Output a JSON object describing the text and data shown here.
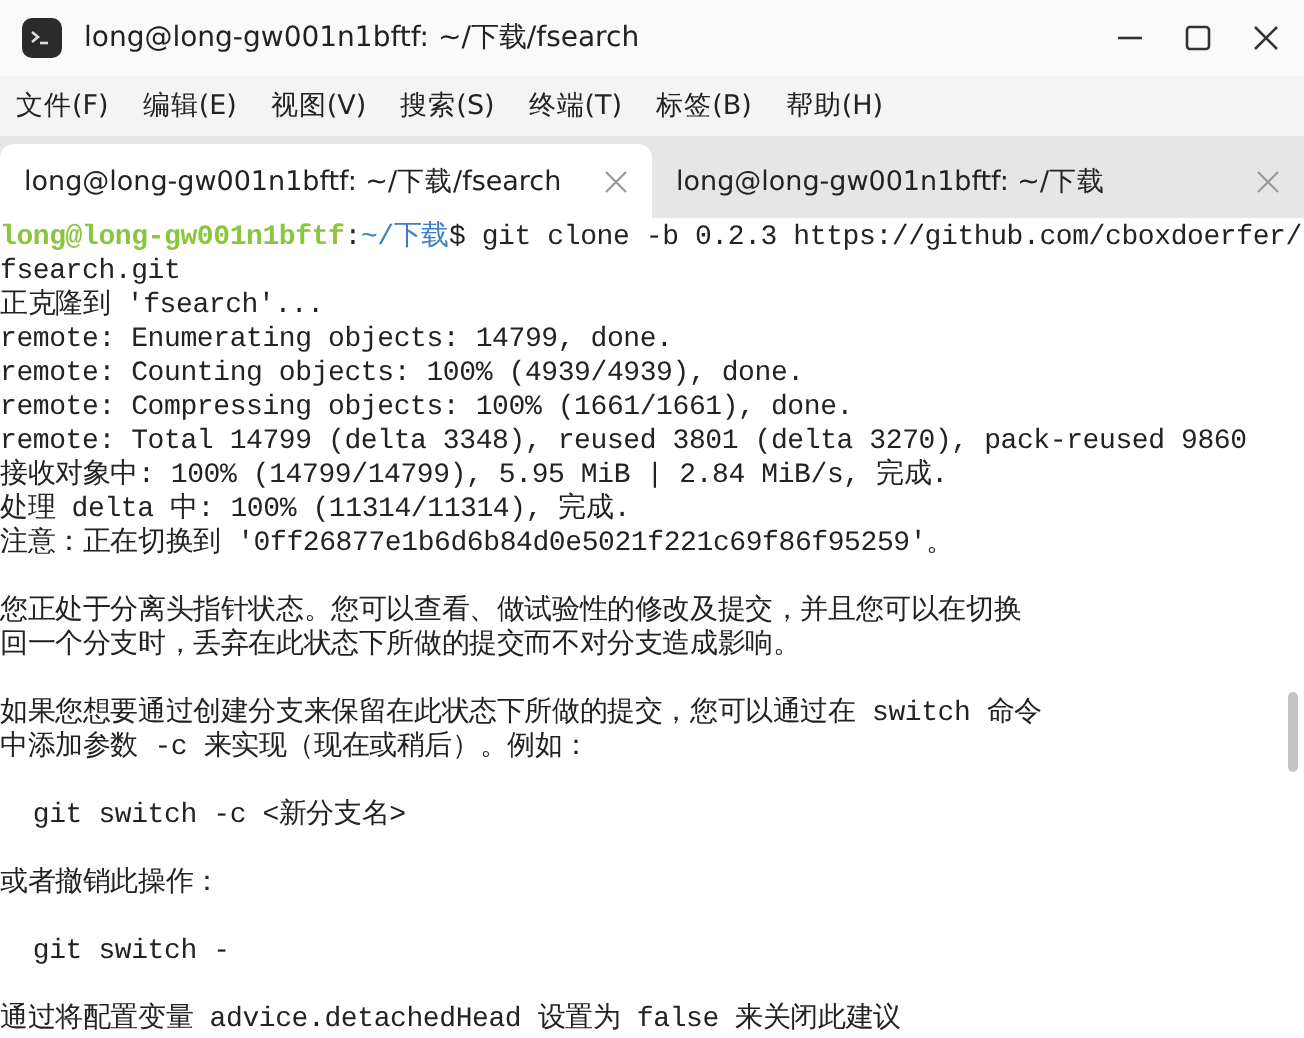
{
  "window": {
    "title": "long@long-gw001n1bftf: ~/下载/fsearch"
  },
  "menu": [
    "文件(F)",
    "编辑(E)",
    "视图(V)",
    "搜索(S)",
    "终端(T)",
    "标签(B)",
    "帮助(H)"
  ],
  "tabs": [
    {
      "label": "long@long-gw001n1bftf: ~/下载/fsearch",
      "selected": true
    },
    {
      "label": "long@long-gw001n1bftf: ~/下载",
      "selected": false
    }
  ],
  "terminal": {
    "lines": [
      {
        "kind": "prompt",
        "user": "long@long-gw001n1bftf",
        "separator": ":",
        "path": "~/下载",
        "command": "$ git clone -b 0.2.3 https://github.com/cboxdoerfer/"
      },
      {
        "kind": "text",
        "text": "fsearch.git"
      },
      {
        "kind": "text",
        "text": "正克隆到 'fsearch'..."
      },
      {
        "kind": "text",
        "text": "remote: Enumerating objects: 14799, done."
      },
      {
        "kind": "text",
        "text": "remote: Counting objects: 100% (4939/4939), done."
      },
      {
        "kind": "text",
        "text": "remote: Compressing objects: 100% (1661/1661), done."
      },
      {
        "kind": "text",
        "text": "remote: Total 14799 (delta 3348), reused 3801 (delta 3270), pack-reused 9860"
      },
      {
        "kind": "text",
        "text": "接收对象中: 100% (14799/14799), 5.95 MiB | 2.84 MiB/s, 完成."
      },
      {
        "kind": "text",
        "text": "处理 delta 中: 100% (11314/11314), 完成."
      },
      {
        "kind": "text",
        "text": "注意：正在切换到 '0ff26877e1b6d6b84d0e5021f221c69f86f95259'。"
      },
      {
        "kind": "blank"
      },
      {
        "kind": "text",
        "text": "您正处于分离头指针状态。您可以查看、做试验性的修改及提交，并且您可以在切换"
      },
      {
        "kind": "text",
        "text": "回一个分支时，丢弃在此状态下所做的提交而不对分支造成影响。"
      },
      {
        "kind": "blank"
      },
      {
        "kind": "text",
        "text": "如果您想要通过创建分支来保留在此状态下所做的提交，您可以通过在 switch 命令"
      },
      {
        "kind": "text",
        "text": "中添加参数 -c 来实现（现在或稍后）。例如："
      },
      {
        "kind": "blank"
      },
      {
        "kind": "text",
        "text": "  git switch -c <新分支名>"
      },
      {
        "kind": "blank"
      },
      {
        "kind": "text",
        "text": "或者撤销此操作："
      },
      {
        "kind": "blank"
      },
      {
        "kind": "text",
        "text": "  git switch -"
      },
      {
        "kind": "blank"
      },
      {
        "kind": "text",
        "text": "通过将配置变量 advice.detachedHead 设置为 false 来关闭此建议"
      }
    ]
  }
}
